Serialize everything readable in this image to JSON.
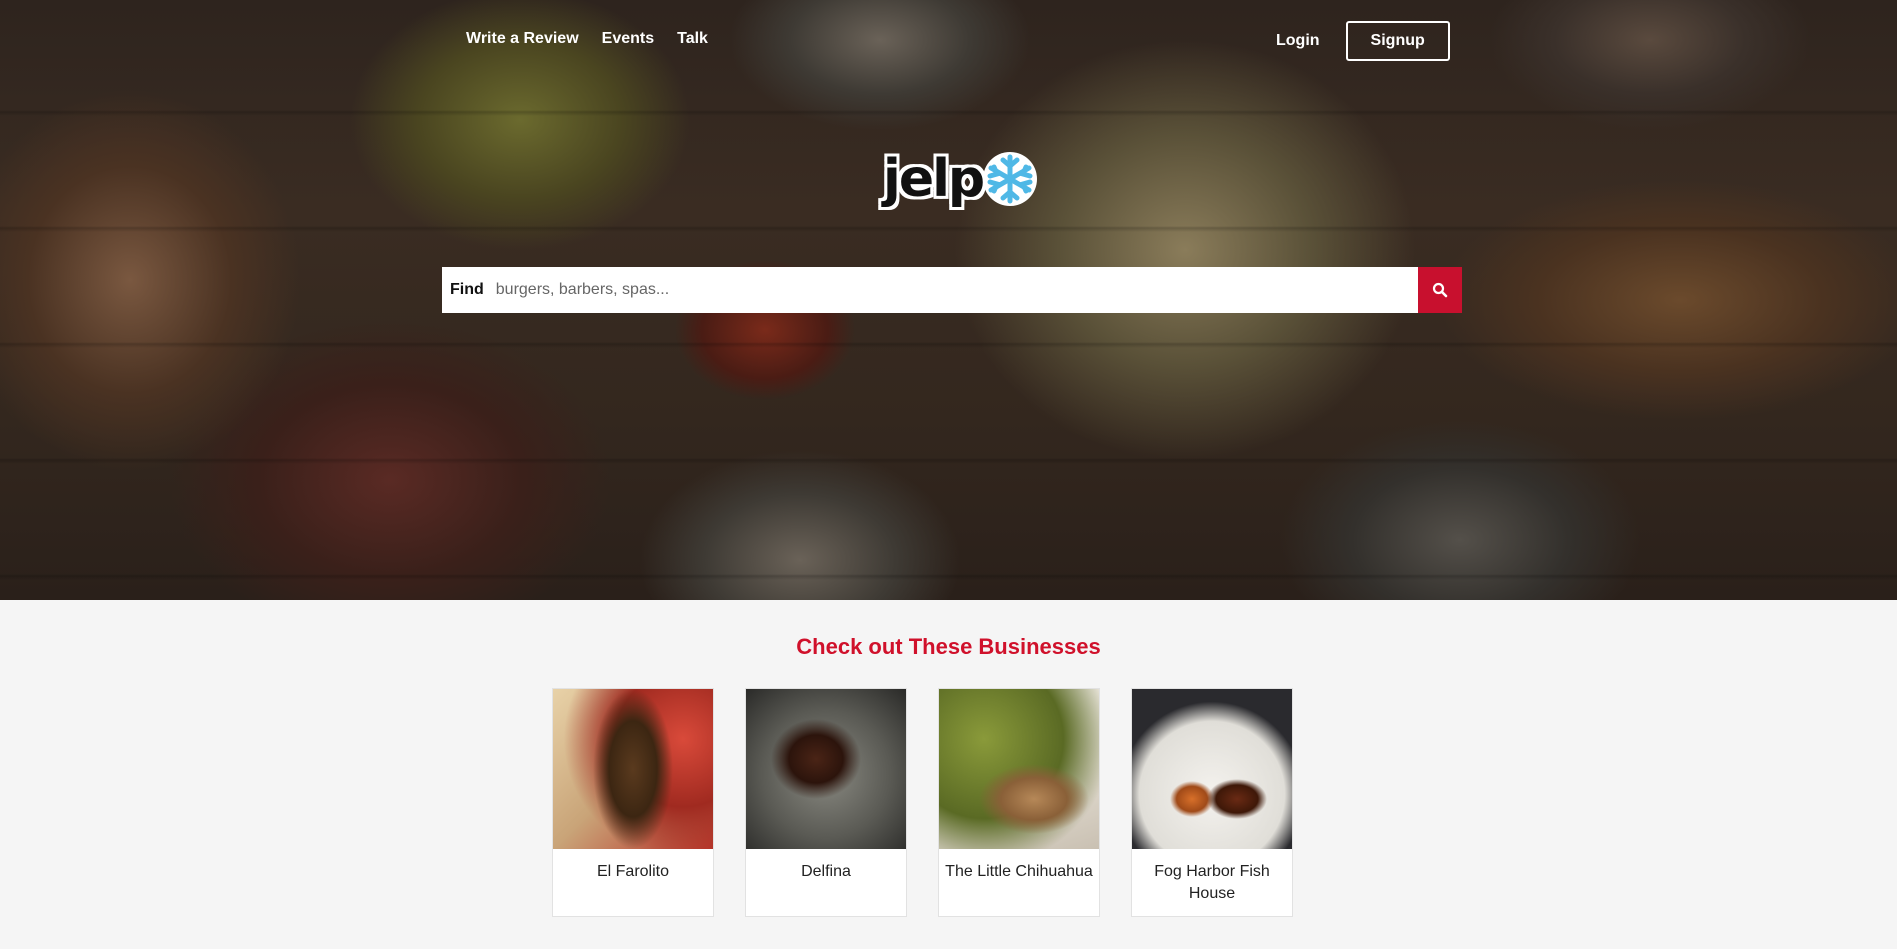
{
  "nav": {
    "links": [
      "Write a Review",
      "Events",
      "Talk"
    ],
    "login_label": "Login",
    "signup_label": "Signup"
  },
  "logo": {
    "text": "jelp",
    "icon": "snowflake-icon"
  },
  "search": {
    "label": "Find",
    "placeholder": "burgers, barbers, spas...",
    "value": "",
    "button_icon": "search-icon"
  },
  "featured": {
    "title": "Check out These Businesses",
    "businesses": [
      {
        "name": "El Farolito"
      },
      {
        "name": "Delfina"
      },
      {
        "name": "The Little Chihuahua"
      },
      {
        "name": "Fog Harbor Fish House"
      }
    ]
  },
  "colors": {
    "brand": "#c8102e",
    "title": "#d0112b",
    "background": "#f5f5f5"
  }
}
